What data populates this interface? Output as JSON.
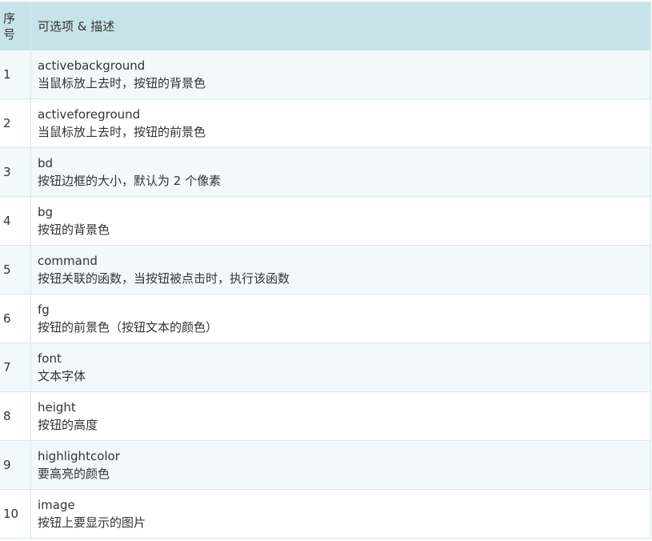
{
  "header": {
    "num_line1": "序",
    "num_line2": "号",
    "desc": "可选项 & 描述"
  },
  "rows": [
    {
      "num": "1",
      "name": "activebackground",
      "desc": "当鼠标放上去时，按钮的背景色"
    },
    {
      "num": "2",
      "name": "activeforeground",
      "desc": "当鼠标放上去时，按钮的前景色"
    },
    {
      "num": "3",
      "name": "bd",
      "desc": "按钮边框的大小，默认为 2 个像素"
    },
    {
      "num": "4",
      "name": "bg",
      "desc": "按钮的背景色"
    },
    {
      "num": "5",
      "name": "command",
      "desc": "按钮关联的函数，当按钮被点击时，执行该函数"
    },
    {
      "num": "6",
      "name": "fg",
      "desc": "按钮的前景色（按钮文本的颜色）"
    },
    {
      "num": "7",
      "name": "font",
      "desc": "文本字体"
    },
    {
      "num": "8",
      "name": "height",
      "desc": "按钮的高度"
    },
    {
      "num": "9",
      "name": "highlightcolor",
      "desc": "要高亮的颜色"
    },
    {
      "num": "10",
      "name": "image",
      "desc": "按钮上要显示的图片"
    }
  ],
  "colors": {
    "header_bg": "#c6e4e7",
    "row_alt_bg": "#f2f9fa",
    "border": "#d4e8eb",
    "text": "#333333"
  }
}
